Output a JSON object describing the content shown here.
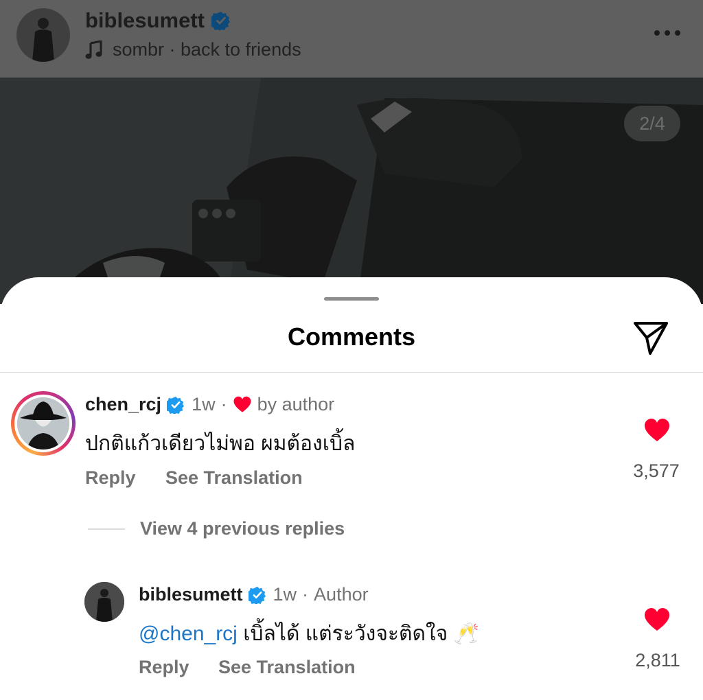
{
  "post": {
    "username": "biblesumett",
    "music": "sombr · back to friends",
    "page_counter": "2/4"
  },
  "sheet": {
    "title": "Comments"
  },
  "comment": {
    "username": "chen_rcj",
    "time": "1w",
    "separator": "·",
    "liked_by": "by author",
    "text": "ปกติแก้วเดียวไม่พอ ผมต้องเบิ้ล",
    "reply_label": "Reply",
    "translate_label": "See Translation",
    "likes": "3,577"
  },
  "view_replies": "View 4 previous replies",
  "reply": {
    "username": "biblesumett",
    "time": "1w",
    "separator": "·",
    "role": "Author",
    "mention": "@chen_rcj",
    "text": " เบิ้ลได้ แต่ระวังจะติดใจ ",
    "emoji": "🥂",
    "reply_label": "Reply",
    "translate_label": "See Translation",
    "likes": "2,811"
  },
  "colors": {
    "verified": "#1d9bf0",
    "heart": "#ff0033",
    "mention": "#1a76c9"
  }
}
